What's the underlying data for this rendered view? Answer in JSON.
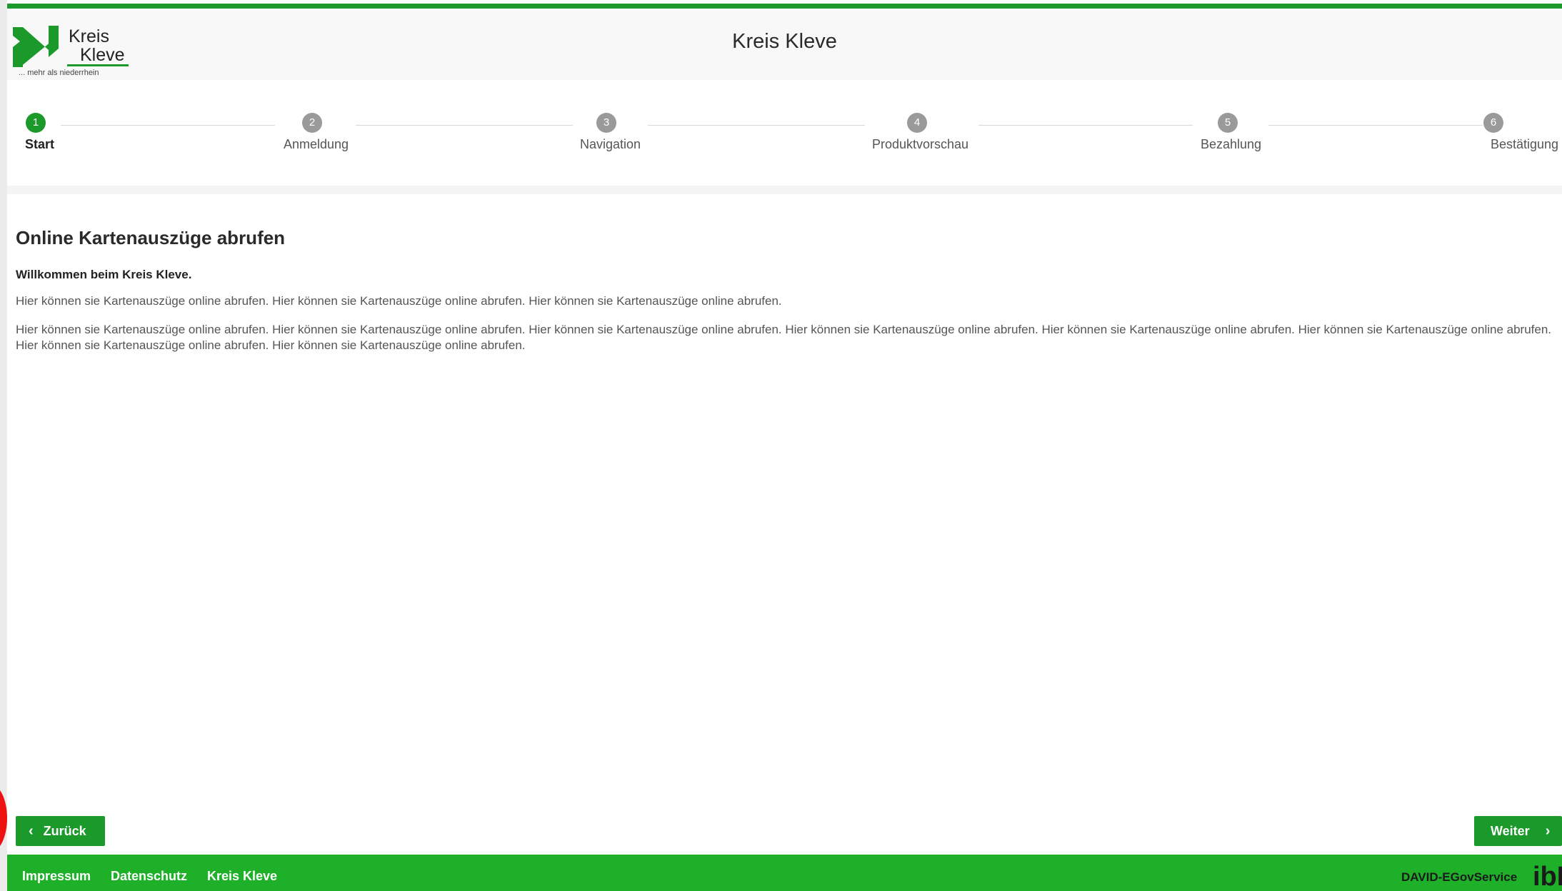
{
  "header": {
    "logo": {
      "line1": "Kreis",
      "line2": "Kleve",
      "tagline": "... mehr als niederrhein"
    },
    "title": "Kreis Kleve"
  },
  "steps": [
    {
      "number": "1",
      "label": "Start",
      "active": true
    },
    {
      "number": "2",
      "label": "Anmeldung",
      "active": false
    },
    {
      "number": "3",
      "label": "Navigation",
      "active": false
    },
    {
      "number": "4",
      "label": "Produktvorschau",
      "active": false
    },
    {
      "number": "5",
      "label": "Bezahlung",
      "active": false
    },
    {
      "number": "6",
      "label": "Bestätigung",
      "active": false
    }
  ],
  "main": {
    "heading": "Online Kartenauszüge abrufen",
    "welcome": "Willkommen beim Kreis Kleve.",
    "paragraph1": "Hier können sie Kartenauszüge online abrufen. Hier können sie Kartenauszüge online abrufen. Hier können sie Kartenauszüge online abrufen.",
    "paragraph2": "Hier können sie Kartenauszüge online abrufen. Hier können sie Kartenauszüge online abrufen. Hier können sie Kartenauszüge online abrufen. Hier können sie Kartenauszüge online abrufen. Hier können sie Kartenauszüge online abrufen. Hier können sie Kartenauszüge online abrufen. Hier können sie Kartenauszüge online abrufen. Hier können sie Kartenauszüge online abrufen."
  },
  "nav": {
    "back_label": "Zurück",
    "next_label": "Weiter",
    "back_icon": "chevron-left-icon",
    "next_icon": "chevron-right-icon"
  },
  "footer": {
    "links": [
      "Impressum",
      "Datenschutz",
      "Kreis Kleve"
    ],
    "service": "DAVID-EGovService",
    "vendor_logo": "ibR"
  },
  "colors": {
    "accent": "#1b9a2b",
    "footer": "#1fb02a",
    "inactive_step": "#9a9a9a",
    "marker": "#ee1111"
  }
}
